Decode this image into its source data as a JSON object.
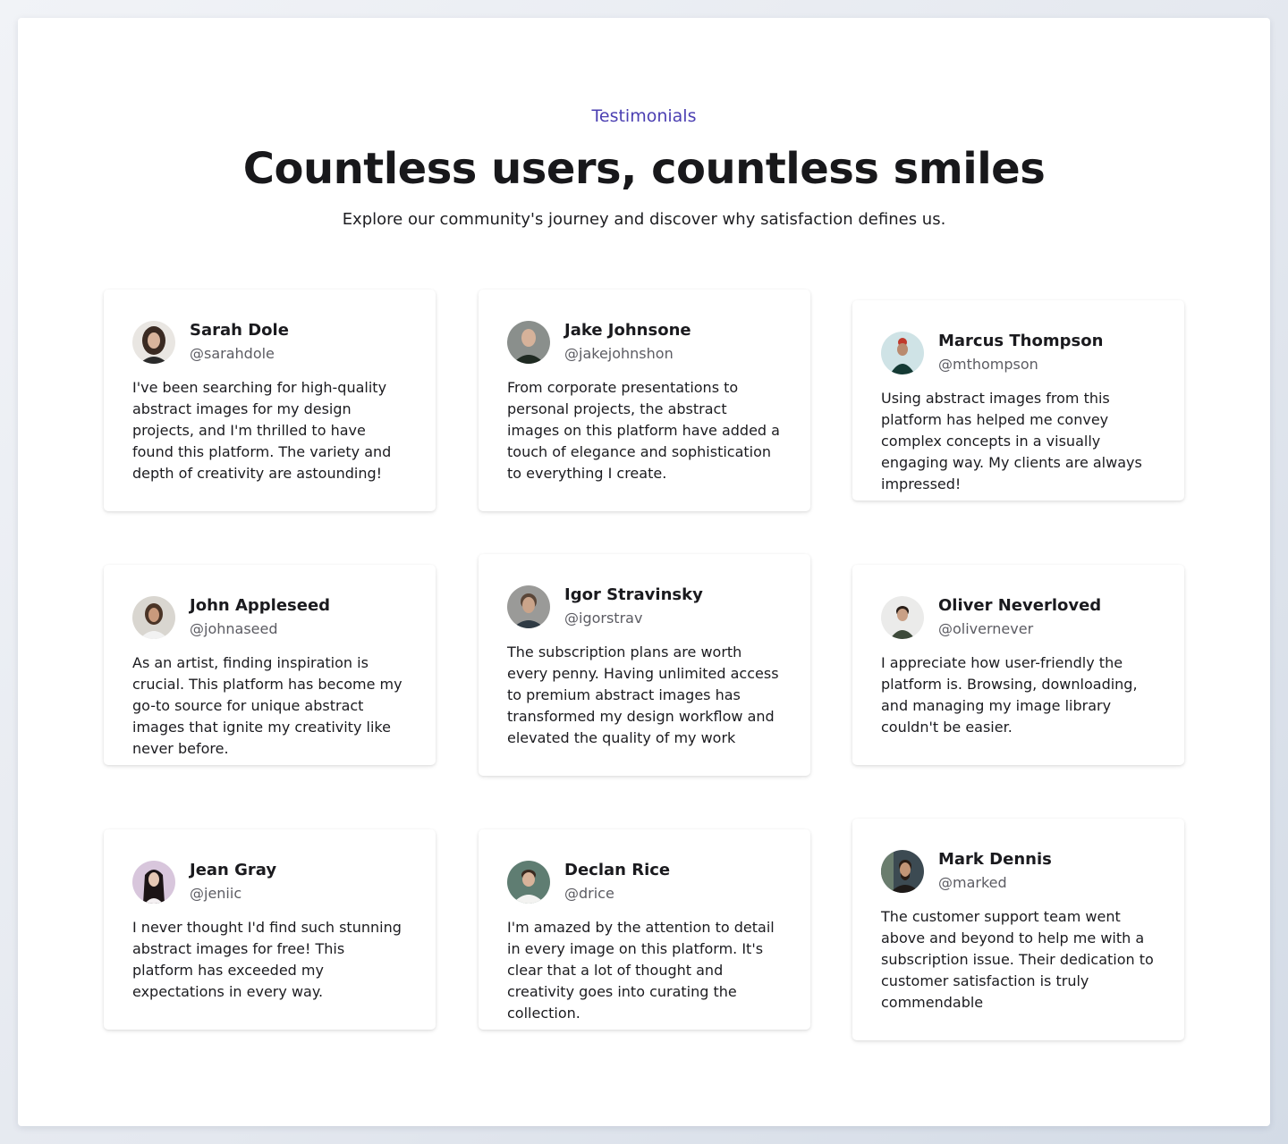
{
  "header": {
    "eyebrow": "Testimonials",
    "title": "Countless users, countless smiles",
    "subtitle": "Explore our community's journey and discover why satisfaction defines us."
  },
  "colors": {
    "accent": "#4b3fb2",
    "card_bg": "#ffffff",
    "page_bg": "#e4e8ef"
  },
  "testimonials": [
    {
      "name": "Sarah Dole",
      "handle": "@sarahdole",
      "avatar_icon": "avatar-photo-icon",
      "quote": "I've been searching for high-quality abstract images for my design projects, and I'm thrilled to have found this platform. The variety and depth of creativity are astounding!"
    },
    {
      "name": "Jake Johnsone",
      "handle": "@jakejohnshon",
      "avatar_icon": "avatar-photo-icon",
      "quote": "From corporate presentations to personal projects, the abstract images on this platform have added a touch of elegance and sophistication to everything I create."
    },
    {
      "name": "Marcus Thompson",
      "handle": "@mthompson",
      "avatar_icon": "avatar-photo-icon",
      "quote": "Using abstract images from this platform has helped me convey complex concepts in a visually engaging way. My clients are always impressed!"
    },
    {
      "name": "John Appleseed",
      "handle": "@johnaseed",
      "avatar_icon": "avatar-photo-icon",
      "quote": "As an artist, finding inspiration is crucial. This platform has become my go-to source for unique abstract images that ignite my creativity like never before."
    },
    {
      "name": "Igor Stravinsky",
      "handle": "@igorstrav",
      "avatar_icon": "avatar-photo-icon",
      "quote": "The subscription plans are worth every penny. Having unlimited access to premium abstract images has transformed my design workflow and elevated the quality of my work"
    },
    {
      "name": "Oliver Neverloved",
      "handle": "@olivernever",
      "avatar_icon": "avatar-photo-icon",
      "quote": "I appreciate how user-friendly the platform is. Browsing, downloading, and managing my image library couldn't be easier."
    },
    {
      "name": "Jean Gray",
      "handle": "@jeniic",
      "avatar_icon": "avatar-photo-icon",
      "quote": "I never thought I'd find such stunning abstract images for free! This platform has exceeded my expectations in every way."
    },
    {
      "name": "Declan Rice",
      "handle": "@drice",
      "avatar_icon": "avatar-photo-icon",
      "quote": "I'm amazed by the attention to detail in every image on this platform. It's clear that a lot of thought and creativity goes into curating the collection."
    },
    {
      "name": "Mark Dennis",
      "handle": "@marked",
      "avatar_icon": "avatar-photo-icon",
      "quote": "The customer support team went above and beyond to help me with a subscription issue. Their dedication to customer satisfaction is truly commendable"
    }
  ]
}
